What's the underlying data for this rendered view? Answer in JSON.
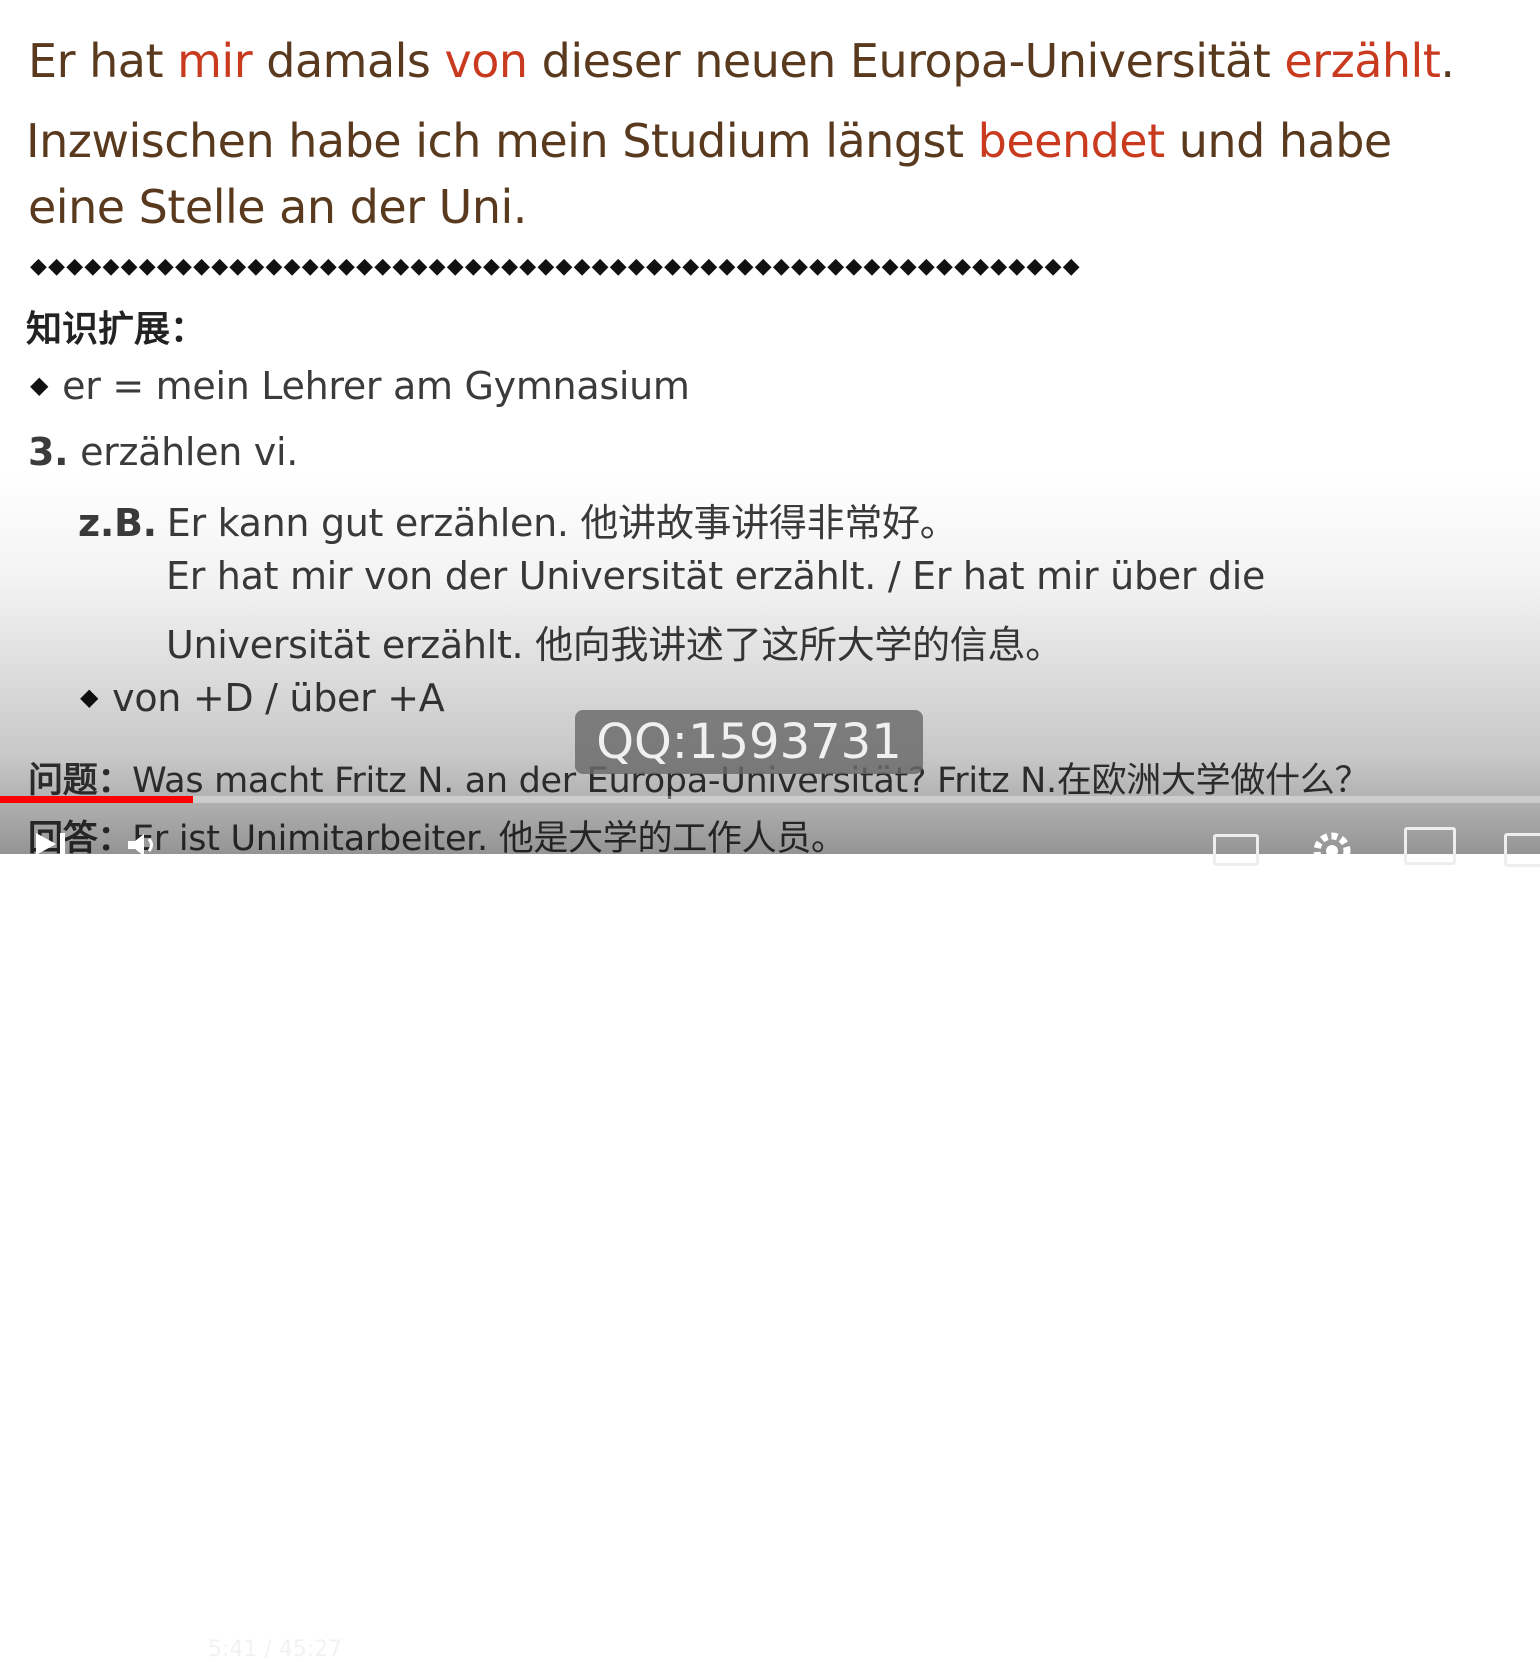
{
  "slide": {
    "line1": [
      {
        "t": "Er hat ",
        "red": false
      },
      {
        "t": "mir",
        "red": true
      },
      {
        "t": " damals ",
        "red": false
      },
      {
        "t": "von",
        "red": true
      },
      {
        "t": " dieser neuen Europa-Universität ",
        "red": false
      },
      {
        "t": "erzählt",
        "red": true
      },
      {
        "t": ".",
        "red": false
      }
    ],
    "line2": [
      {
        "t": "Inzwischen habe ich mein Studium längst ",
        "red": false
      },
      {
        "t": "beendet",
        "red": true
      },
      {
        "t": " und habe",
        "red": false
      }
    ],
    "line3": "eine Stelle an der Uni.",
    "divider": "◆◆◆◆◆◆◆◆◆◆◆◆◆◆◆◆◆◆◆◆◆◆◆◆◆◆◆◆◆◆◆◆◆◆◆◆◆◆◆◆◆◆◆◆◆◆◆◆◆◆◆◆◆◆◆◆◆◆",
    "heading": "知识扩展：",
    "bullet_glyph": "◆",
    "bullet1": "er = mein Lehrer am Gymnasium",
    "item_number": "3.",
    "item_text": "erzählen vi.",
    "zb_label": "z.B.",
    "ex1": "Er kann gut erzählen. 他讲故事讲得非常好。",
    "ex2a": "Er hat mir von der Universität erzählt. / Er hat mir über die",
    "ex2b": "Universität erzählt. 他向我讲述了这所大学的信息。",
    "bullet2": "von +D / über +A",
    "q_label": "问题：",
    "q_text": "Was macht Fritz N. an der Europa-Universität? Fritz N.在欧洲大学做什么？",
    "a_label": "回答：",
    "a_text": "Er ist Unimitarbeiter. 他是大学的工作人员。"
  },
  "watermark": "QQ:1593731",
  "player": {
    "time": "5:41 / 45:27",
    "progress_fraction": 0.125,
    "buffered_fraction": 0.088,
    "colors": {
      "played": "#ff0000",
      "highlight": "#c93a1e"
    },
    "icons": [
      "play-icon",
      "volume-icon",
      "subtitles-icon",
      "settings-icon",
      "miniplayer-icon",
      "theater-icon"
    ]
  }
}
